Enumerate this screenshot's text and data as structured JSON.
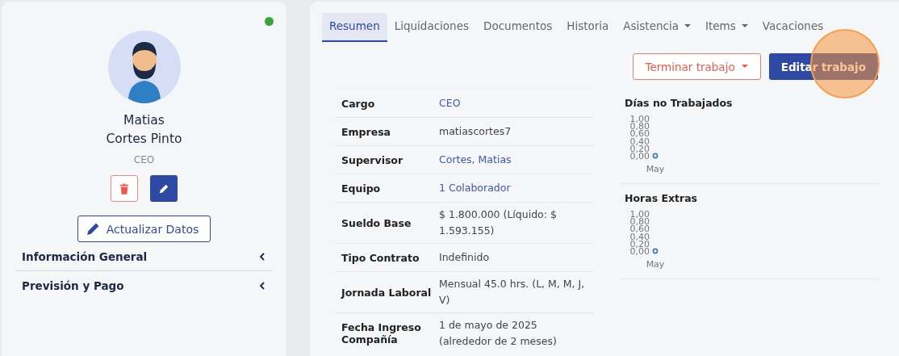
{
  "profile": {
    "online": true,
    "first_name": "Matias",
    "last_name": "Cortes Pinto",
    "role": "CEO",
    "update_button": "Actualizar Datos",
    "sections": [
      {
        "label": "Información General",
        "expanded": false
      },
      {
        "label": "Previsión y Pago",
        "expanded": false
      }
    ]
  },
  "tabs": [
    {
      "label": "Resumen",
      "selected": true,
      "dropdown": false
    },
    {
      "label": "Liquidaciones",
      "selected": false,
      "dropdown": false
    },
    {
      "label": "Documentos",
      "selected": false,
      "dropdown": false
    },
    {
      "label": "Historia",
      "selected": false,
      "dropdown": false
    },
    {
      "label": "Asistencia",
      "selected": false,
      "dropdown": true
    },
    {
      "label": "Items",
      "selected": false,
      "dropdown": true
    },
    {
      "label": "Vacaciones",
      "selected": false,
      "dropdown": false
    }
  ],
  "actions": {
    "terminate": "Terminar trabajo",
    "edit": "Editar trabajo"
  },
  "details": [
    {
      "label": "Cargo",
      "value": "CEO",
      "link": true
    },
    {
      "label": "Empresa",
      "value": "matiascortes7",
      "link": false
    },
    {
      "label": "Supervisor",
      "value": "Cortes, Matias",
      "link": true
    },
    {
      "label": "Equipo",
      "value": "1 Colaborador",
      "link": true
    },
    {
      "label": "Sueldo Base",
      "value": "$ 1.800.000 (Líquido: $ 1.593.155)",
      "link": false
    },
    {
      "label": "Tipo Contrato",
      "value": "Indefinido",
      "link": false
    },
    {
      "label": "Jornada Laboral",
      "value": "Mensual 45.0 hrs. (L, M, M, J, V)",
      "link": false
    },
    {
      "label": "Fecha Ingreso Compañía",
      "value": "1 de mayo de 2025 (alrededor de 2 meses)",
      "link": false
    }
  ],
  "charts": [
    {
      "title": "Días no Trabajados",
      "chart_data": {
        "type": "scatter",
        "categories": [
          "May"
        ],
        "series": [
          {
            "color": "#3d7ab8",
            "values": [
              0
            ]
          }
        ],
        "ylim": [
          0,
          1
        ],
        "yticks": [
          {
            "value": 0,
            "label": "0,00"
          },
          {
            "value": 0.2,
            "label": "0,20"
          },
          {
            "value": 0.4,
            "label": "0,40"
          },
          {
            "value": 0.6,
            "label": "0,60"
          },
          {
            "value": 0.8,
            "label": "0,80"
          },
          {
            "value": 1,
            "label": "1,00"
          }
        ]
      }
    },
    {
      "title": "Horas Extras",
      "chart_data": {
        "type": "scatter",
        "categories": [
          "May"
        ],
        "series": [
          {
            "color": "#3d7ab8",
            "values": [
              0
            ]
          }
        ],
        "ylim": [
          0,
          1
        ],
        "yticks": [
          {
            "value": 0,
            "label": "0,00"
          },
          {
            "value": 0.2,
            "label": "0,20"
          },
          {
            "value": 0.4,
            "label": "0,40"
          },
          {
            "value": 0.6,
            "label": "0,60"
          },
          {
            "value": 0.8,
            "label": "0,80"
          },
          {
            "value": 1,
            "label": "1,00"
          }
        ]
      }
    }
  ]
}
